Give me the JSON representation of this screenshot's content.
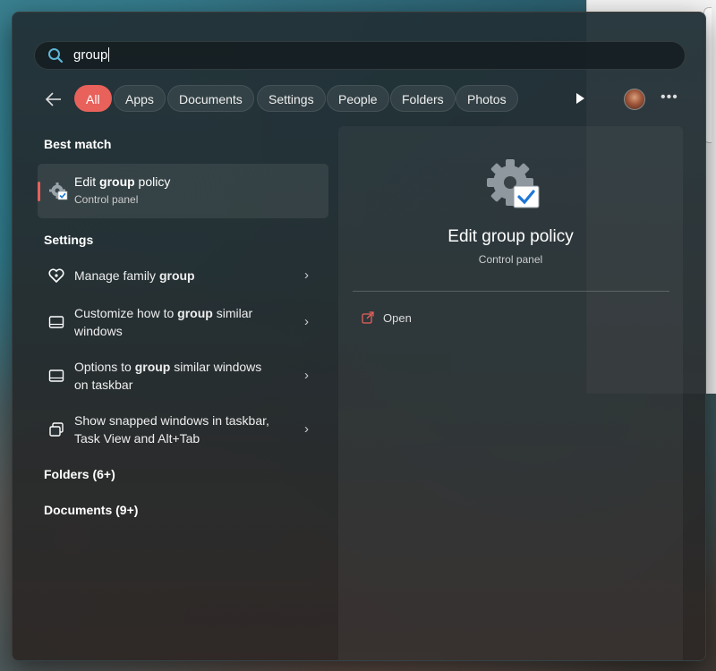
{
  "search": {
    "query": "group"
  },
  "filters": {
    "back": "back-arrow",
    "chips": [
      "All",
      "Apps",
      "Documents",
      "Settings",
      "People",
      "Folders",
      "Photos"
    ],
    "more": "•••"
  },
  "results": {
    "best_match_heading": "Best match",
    "best_match": {
      "pre": "Edit ",
      "bold": "group",
      "post": " policy",
      "subtitle": "Control panel"
    },
    "settings_heading": "Settings",
    "settings": [
      {
        "icon": "heart-family-icon",
        "l1_pre": "Manage family ",
        "l1_bold": "group",
        "l1_post": "",
        "l2": ""
      },
      {
        "icon": "taskbar-icon",
        "l1_pre": "Customize how to ",
        "l1_bold": "group",
        "l1_post": " similar",
        "l2": "windows"
      },
      {
        "icon": "taskbar-icon",
        "l1_pre": "Options to ",
        "l1_bold": "group",
        "l1_post": " similar windows",
        "l2": "on taskbar"
      },
      {
        "icon": "snapped-windows-icon",
        "l1_pre": "Show snapped windows in taskbar,",
        "l1_bold": "",
        "l1_post": "",
        "l2": "Task View and Alt+Tab"
      }
    ],
    "folders_heading": "Folders (6+)",
    "documents_heading": "Documents (9+)"
  },
  "detail": {
    "title": "Edit group policy",
    "subtitle": "Control panel",
    "action_open": "Open"
  },
  "colors": {
    "accent": "#e8615a"
  }
}
